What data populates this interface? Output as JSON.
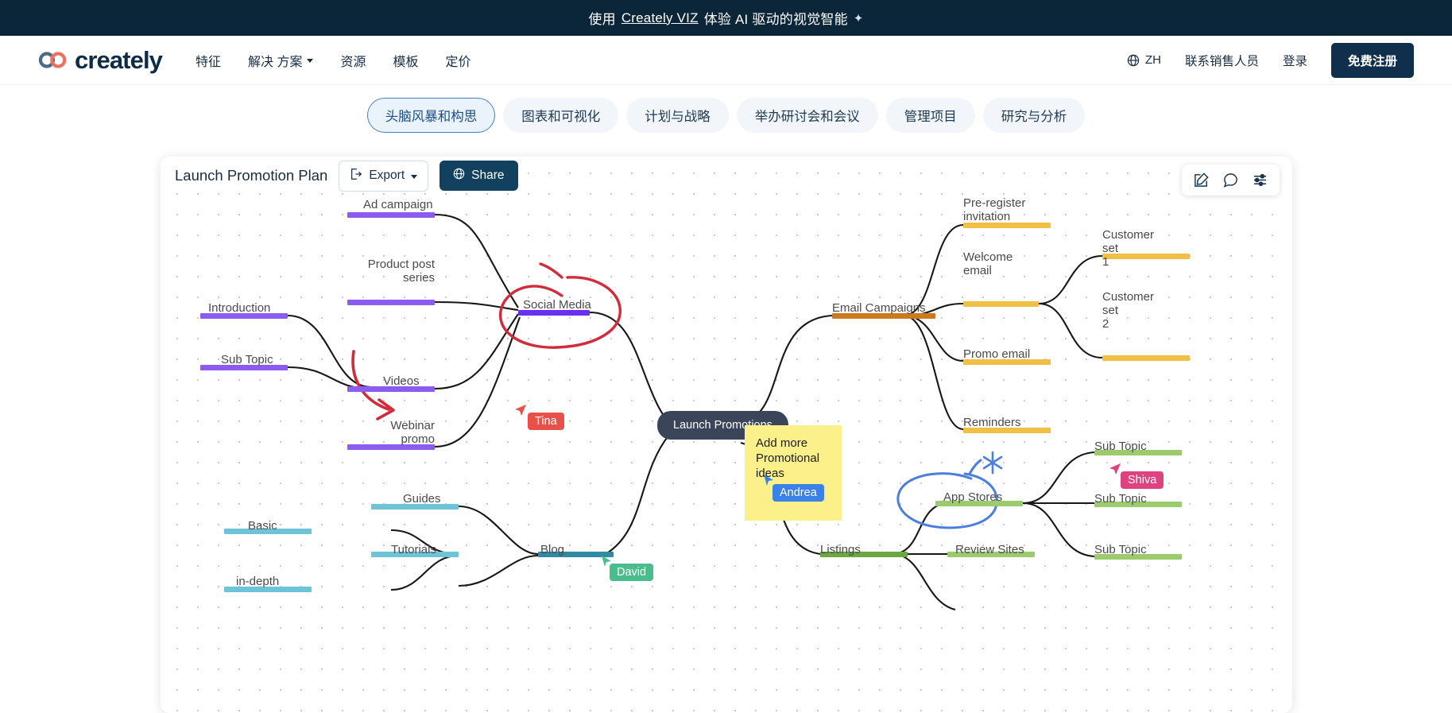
{
  "banner": {
    "prefix": "使用 ",
    "link": "Creately VIZ",
    "suffix": " 体验 AI 驱动的视觉智能",
    "sparkle": "✦",
    "bg_color": "#0b2539"
  },
  "header": {
    "logo_text": "creately",
    "logo_icon": "creately-infinity-logo",
    "nav": [
      {
        "label": "特征",
        "has_caret": false
      },
      {
        "label": "解决 方案",
        "has_caret": true
      },
      {
        "label": "资源",
        "has_caret": false
      },
      {
        "label": "模板",
        "has_caret": false
      },
      {
        "label": "定价",
        "has_caret": false
      }
    ],
    "language": "ZH",
    "language_icon": "globe-icon",
    "contact_sales": "联系销售人员",
    "login": "登录",
    "signup": "免费注册",
    "signup_bg": "#102f4c"
  },
  "subtabs": [
    {
      "label": "头脑风暴和构思",
      "active": true
    },
    {
      "label": "图表和可视化",
      "active": false
    },
    {
      "label": "计划与战略",
      "active": false
    },
    {
      "label": "举办研讨会和会议",
      "active": false
    },
    {
      "label": "管理项目",
      "active": false
    },
    {
      "label": "研究与分析",
      "active": false
    }
  ],
  "canvas": {
    "doc_title": "Launch Promotion Plan",
    "export_label": "Export",
    "export_icon": "export-icon",
    "export_caret_icon": "chevron-down-icon",
    "share_label": "Share",
    "share_icon": "globe-icon",
    "tool_icons": [
      "edit-pencil-icon",
      "comment-bubble-icon",
      "settings-sliders-icon"
    ]
  },
  "mindmap": {
    "center": {
      "label": "Launch Promotions",
      "color": "#3b4559"
    },
    "sticky_note": {
      "text": "Add more Promotional ideas",
      "color": "#fbf08a"
    },
    "branch_colors": {
      "social": "#8c5cf0",
      "email_parent": "#cd7a1f",
      "email_child": "#f1bf46",
      "blog_parent": "#2f8ba3",
      "blog_child": "#6cc4d6",
      "listings_parent": "#6aa842",
      "listings_child": "#9ccb6e"
    },
    "nodes": [
      {
        "label": "Ad campaign",
        "group": "social"
      },
      {
        "label": "Product post\nseries",
        "group": "social"
      },
      {
        "label": "Introduction",
        "group": "social"
      },
      {
        "label": "Sub Topic",
        "group": "social"
      },
      {
        "label": "Videos",
        "group": "social"
      },
      {
        "label": "Webinar\npromo",
        "group": "social"
      },
      {
        "label": "Social Media",
        "group": "social"
      },
      {
        "label": "Email Campaigns",
        "group": "email_parent"
      },
      {
        "label": "Pre-register\ninvitation",
        "group": "email_child"
      },
      {
        "label": "Welcome\nemail",
        "group": "email_child"
      },
      {
        "label": "Promo email",
        "group": "email_child"
      },
      {
        "label": "Reminders",
        "group": "email_child"
      },
      {
        "label": "Customer set\n1",
        "group": "email_child"
      },
      {
        "label": "Customer set\n2",
        "group": "email_child"
      },
      {
        "label": "Guides",
        "group": "blog_child"
      },
      {
        "label": "Basic",
        "group": "blog_child"
      },
      {
        "label": "Tutorials",
        "group": "blog_child"
      },
      {
        "label": "in-depth",
        "group": "blog_child"
      },
      {
        "label": "Blog",
        "group": "blog_parent"
      },
      {
        "label": "Listings",
        "group": "listings_parent"
      },
      {
        "label": "Review Sites",
        "group": "listings_child"
      },
      {
        "label": "App Stores",
        "group": "listings_child"
      },
      {
        "label": "Sub Topic",
        "group": "listings_child"
      },
      {
        "label": "Sub Topic",
        "group": "listings_child"
      },
      {
        "label": "Sub Topic",
        "group": "listings_child"
      }
    ],
    "collaborators": [
      {
        "name": "Tina",
        "color": "#e8504a"
      },
      {
        "name": "Andrea",
        "color": "#3b82e8"
      },
      {
        "name": "David",
        "color": "#4bbd8a"
      },
      {
        "name": "Shiva",
        "color": "#e0417f"
      }
    ],
    "annotations": [
      {
        "type": "red-circle-ink",
        "target": "Social Media",
        "color": "#d42b3a"
      },
      {
        "type": "red-arrow-ink",
        "target": "Webinar promo",
        "color": "#d42b3a"
      },
      {
        "type": "blue-circle-ink",
        "target": "App Stores",
        "color": "#4a7fe0"
      },
      {
        "type": "blue-asterisk-ink",
        "target": "App Stores",
        "color": "#4a7fe0"
      }
    ]
  }
}
